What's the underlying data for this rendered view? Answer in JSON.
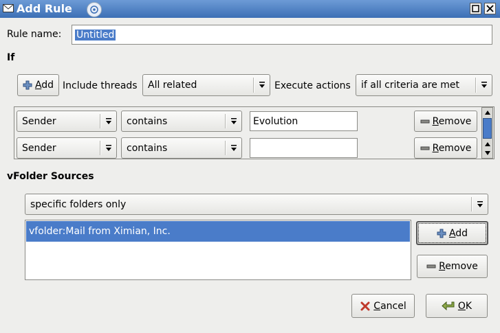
{
  "window": {
    "title": "Add Rule"
  },
  "rule_name": {
    "label": "Rule name:",
    "value": "Untitled"
  },
  "if_section": {
    "heading": "If",
    "add_button": {
      "pre": "",
      "mnemonic": "A",
      "post": "dd"
    },
    "include_threads_label": "Include threads",
    "include_threads_value": "All related",
    "execute_actions_label": "Execute actions",
    "execute_actions_value": "if all criteria are met",
    "criteria": [
      {
        "field": "Sender",
        "operator": "contains",
        "value": "Evolution",
        "remove": {
          "mnemonic": "R",
          "post": "emove"
        }
      },
      {
        "field": "Sender",
        "operator": "contains",
        "value": "",
        "remove": {
          "mnemonic": "R",
          "post": "emove"
        }
      }
    ]
  },
  "vfolder": {
    "heading": "vFolder Sources",
    "source_mode": "specific folders only",
    "sources": [
      "vfolder:Mail from Ximian, Inc."
    ],
    "add_button": {
      "mnemonic": "A",
      "post": "dd"
    },
    "remove_button": {
      "mnemonic": "R",
      "post": "emove"
    }
  },
  "footer": {
    "cancel_button": {
      "mnemonic": "C",
      "post": "ancel"
    },
    "ok_button": {
      "mnemonic": "O",
      "post": "K"
    }
  }
}
